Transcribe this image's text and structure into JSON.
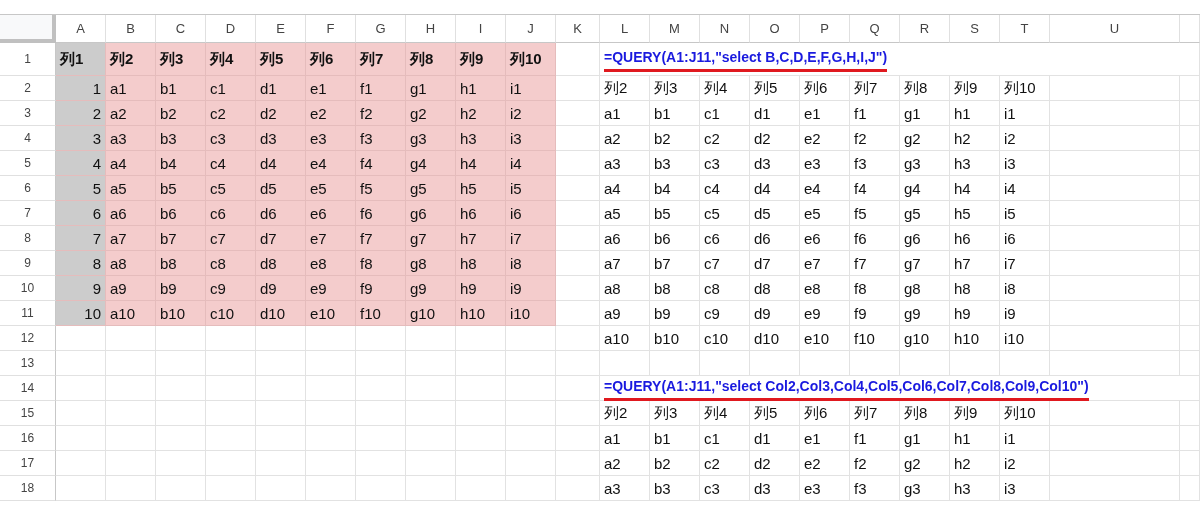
{
  "columns": [
    "A",
    "B",
    "C",
    "D",
    "E",
    "F",
    "G",
    "H",
    "I",
    "J",
    "K",
    "L",
    "M",
    "N",
    "O",
    "P",
    "Q",
    "R",
    "S",
    "T",
    "U"
  ],
  "rows": [
    {
      "number": "1",
      "cells": [
        {
          "kind": "key_header",
          "text": "列1"
        },
        {
          "kind": "header",
          "text": "列2"
        },
        {
          "kind": "header",
          "text": "列3"
        },
        {
          "kind": "header",
          "text": "列4"
        },
        {
          "kind": "header",
          "text": "列5"
        },
        {
          "kind": "header",
          "text": "列6"
        },
        {
          "kind": "header",
          "text": "列7"
        },
        {
          "kind": "header",
          "text": "列8"
        },
        {
          "kind": "header",
          "text": "列9"
        },
        {
          "kind": "header",
          "text": "列10"
        },
        null,
        {
          "kind": "formula",
          "text": "=QUERY(A1:J11,\"select B,C,D,E,F,G,H,I,J\")"
        }
      ]
    },
    {
      "number": "2",
      "cells": [
        {
          "kind": "key",
          "text": "1"
        },
        {
          "kind": "data",
          "text": "a1"
        },
        {
          "kind": "data",
          "text": "b1"
        },
        {
          "kind": "data",
          "text": "c1"
        },
        {
          "kind": "data",
          "text": "d1"
        },
        {
          "kind": "data",
          "text": "e1"
        },
        {
          "kind": "data",
          "text": "f1"
        },
        {
          "kind": "data",
          "text": "g1"
        },
        {
          "kind": "data",
          "text": "h1"
        },
        {
          "kind": "data",
          "text": "i1"
        },
        null,
        {
          "kind": "output",
          "text": "列2"
        },
        {
          "kind": "output",
          "text": "列3"
        },
        {
          "kind": "output",
          "text": "列4"
        },
        {
          "kind": "output",
          "text": "列5"
        },
        {
          "kind": "output",
          "text": "列6"
        },
        {
          "kind": "output",
          "text": "列7"
        },
        {
          "kind": "output",
          "text": "列8"
        },
        {
          "kind": "output",
          "text": "列9"
        },
        {
          "kind": "output",
          "text": "列10"
        }
      ]
    },
    {
      "number": "3",
      "cells": [
        {
          "kind": "key",
          "text": "2"
        },
        {
          "kind": "data",
          "text": "a2"
        },
        {
          "kind": "data",
          "text": "b2"
        },
        {
          "kind": "data",
          "text": "c2"
        },
        {
          "kind": "data",
          "text": "d2"
        },
        {
          "kind": "data",
          "text": "e2"
        },
        {
          "kind": "data",
          "text": "f2"
        },
        {
          "kind": "data",
          "text": "g2"
        },
        {
          "kind": "data",
          "text": "h2"
        },
        {
          "kind": "data",
          "text": "i2"
        },
        null,
        {
          "kind": "output",
          "text": "a1"
        },
        {
          "kind": "output",
          "text": "b1"
        },
        {
          "kind": "output",
          "text": "c1"
        },
        {
          "kind": "output",
          "text": "d1"
        },
        {
          "kind": "output",
          "text": "e1"
        },
        {
          "kind": "output",
          "text": "f1"
        },
        {
          "kind": "output",
          "text": "g1"
        },
        {
          "kind": "output",
          "text": "h1"
        },
        {
          "kind": "output",
          "text": "i1"
        }
      ]
    },
    {
      "number": "4",
      "cells": [
        {
          "kind": "key",
          "text": "3"
        },
        {
          "kind": "data",
          "text": "a3"
        },
        {
          "kind": "data",
          "text": "b3"
        },
        {
          "kind": "data",
          "text": "c3"
        },
        {
          "kind": "data",
          "text": "d3"
        },
        {
          "kind": "data",
          "text": "e3"
        },
        {
          "kind": "data",
          "text": "f3"
        },
        {
          "kind": "data",
          "text": "g3"
        },
        {
          "kind": "data",
          "text": "h3"
        },
        {
          "kind": "data",
          "text": "i3"
        },
        null,
        {
          "kind": "output",
          "text": "a2"
        },
        {
          "kind": "output",
          "text": "b2"
        },
        {
          "kind": "output",
          "text": "c2"
        },
        {
          "kind": "output",
          "text": "d2"
        },
        {
          "kind": "output",
          "text": "e2"
        },
        {
          "kind": "output",
          "text": "f2"
        },
        {
          "kind": "output",
          "text": "g2"
        },
        {
          "kind": "output",
          "text": "h2"
        },
        {
          "kind": "output",
          "text": "i2"
        }
      ]
    },
    {
      "number": "5",
      "cells": [
        {
          "kind": "key",
          "text": "4"
        },
        {
          "kind": "data",
          "text": "a4"
        },
        {
          "kind": "data",
          "text": "b4"
        },
        {
          "kind": "data",
          "text": "c4"
        },
        {
          "kind": "data",
          "text": "d4"
        },
        {
          "kind": "data",
          "text": "e4"
        },
        {
          "kind": "data",
          "text": "f4"
        },
        {
          "kind": "data",
          "text": "g4"
        },
        {
          "kind": "data",
          "text": "h4"
        },
        {
          "kind": "data",
          "text": "i4"
        },
        null,
        {
          "kind": "output",
          "text": "a3"
        },
        {
          "kind": "output",
          "text": "b3"
        },
        {
          "kind": "output",
          "text": "c3"
        },
        {
          "kind": "output",
          "text": "d3"
        },
        {
          "kind": "output",
          "text": "e3"
        },
        {
          "kind": "output",
          "text": "f3"
        },
        {
          "kind": "output",
          "text": "g3"
        },
        {
          "kind": "output",
          "text": "h3"
        },
        {
          "kind": "output",
          "text": "i3"
        }
      ]
    },
    {
      "number": "6",
      "cells": [
        {
          "kind": "key",
          "text": "5"
        },
        {
          "kind": "data",
          "text": "a5"
        },
        {
          "kind": "data",
          "text": "b5"
        },
        {
          "kind": "data",
          "text": "c5"
        },
        {
          "kind": "data",
          "text": "d5"
        },
        {
          "kind": "data",
          "text": "e5"
        },
        {
          "kind": "data",
          "text": "f5"
        },
        {
          "kind": "data",
          "text": "g5"
        },
        {
          "kind": "data",
          "text": "h5"
        },
        {
          "kind": "data",
          "text": "i5"
        },
        null,
        {
          "kind": "output",
          "text": "a4"
        },
        {
          "kind": "output",
          "text": "b4"
        },
        {
          "kind": "output",
          "text": "c4"
        },
        {
          "kind": "output",
          "text": "d4"
        },
        {
          "kind": "output",
          "text": "e4"
        },
        {
          "kind": "output",
          "text": "f4"
        },
        {
          "kind": "output",
          "text": "g4"
        },
        {
          "kind": "output",
          "text": "h4"
        },
        {
          "kind": "output",
          "text": "i4"
        }
      ]
    },
    {
      "number": "7",
      "cells": [
        {
          "kind": "key",
          "text": "6"
        },
        {
          "kind": "data",
          "text": "a6"
        },
        {
          "kind": "data",
          "text": "b6"
        },
        {
          "kind": "data",
          "text": "c6"
        },
        {
          "kind": "data",
          "text": "d6"
        },
        {
          "kind": "data",
          "text": "e6"
        },
        {
          "kind": "data",
          "text": "f6"
        },
        {
          "kind": "data",
          "text": "g6"
        },
        {
          "kind": "data",
          "text": "h6"
        },
        {
          "kind": "data",
          "text": "i6"
        },
        null,
        {
          "kind": "output",
          "text": "a5"
        },
        {
          "kind": "output",
          "text": "b5"
        },
        {
          "kind": "output",
          "text": "c5"
        },
        {
          "kind": "output",
          "text": "d5"
        },
        {
          "kind": "output",
          "text": "e5"
        },
        {
          "kind": "output",
          "text": "f5"
        },
        {
          "kind": "output",
          "text": "g5"
        },
        {
          "kind": "output",
          "text": "h5"
        },
        {
          "kind": "output",
          "text": "i5"
        }
      ]
    },
    {
      "number": "8",
      "cells": [
        {
          "kind": "key",
          "text": "7"
        },
        {
          "kind": "data",
          "text": "a7"
        },
        {
          "kind": "data",
          "text": "b7"
        },
        {
          "kind": "data",
          "text": "c7"
        },
        {
          "kind": "data",
          "text": "d7"
        },
        {
          "kind": "data",
          "text": "e7"
        },
        {
          "kind": "data",
          "text": "f7"
        },
        {
          "kind": "data",
          "text": "g7"
        },
        {
          "kind": "data",
          "text": "h7"
        },
        {
          "kind": "data",
          "text": "i7"
        },
        null,
        {
          "kind": "output",
          "text": "a6"
        },
        {
          "kind": "output",
          "text": "b6"
        },
        {
          "kind": "output",
          "text": "c6"
        },
        {
          "kind": "output",
          "text": "d6"
        },
        {
          "kind": "output",
          "text": "e6"
        },
        {
          "kind": "output",
          "text": "f6"
        },
        {
          "kind": "output",
          "text": "g6"
        },
        {
          "kind": "output",
          "text": "h6"
        },
        {
          "kind": "output",
          "text": "i6"
        }
      ]
    },
    {
      "number": "9",
      "cells": [
        {
          "kind": "key",
          "text": "8"
        },
        {
          "kind": "data",
          "text": "a8"
        },
        {
          "kind": "data",
          "text": "b8"
        },
        {
          "kind": "data",
          "text": "c8"
        },
        {
          "kind": "data",
          "text": "d8"
        },
        {
          "kind": "data",
          "text": "e8"
        },
        {
          "kind": "data",
          "text": "f8"
        },
        {
          "kind": "data",
          "text": "g8"
        },
        {
          "kind": "data",
          "text": "h8"
        },
        {
          "kind": "data",
          "text": "i8"
        },
        null,
        {
          "kind": "output",
          "text": "a7"
        },
        {
          "kind": "output",
          "text": "b7"
        },
        {
          "kind": "output",
          "text": "c7"
        },
        {
          "kind": "output",
          "text": "d7"
        },
        {
          "kind": "output",
          "text": "e7"
        },
        {
          "kind": "output",
          "text": "f7"
        },
        {
          "kind": "output",
          "text": "g7"
        },
        {
          "kind": "output",
          "text": "h7"
        },
        {
          "kind": "output",
          "text": "i7"
        }
      ]
    },
    {
      "number": "10",
      "cells": [
        {
          "kind": "key",
          "text": "9"
        },
        {
          "kind": "data",
          "text": "a9"
        },
        {
          "kind": "data",
          "text": "b9"
        },
        {
          "kind": "data",
          "text": "c9"
        },
        {
          "kind": "data",
          "text": "d9"
        },
        {
          "kind": "data",
          "text": "e9"
        },
        {
          "kind": "data",
          "text": "f9"
        },
        {
          "kind": "data",
          "text": "g9"
        },
        {
          "kind": "data",
          "text": "h9"
        },
        {
          "kind": "data",
          "text": "i9"
        },
        null,
        {
          "kind": "output",
          "text": "a8"
        },
        {
          "kind": "output",
          "text": "b8"
        },
        {
          "kind": "output",
          "text": "c8"
        },
        {
          "kind": "output",
          "text": "d8"
        },
        {
          "kind": "output",
          "text": "e8"
        },
        {
          "kind": "output",
          "text": "f8"
        },
        {
          "kind": "output",
          "text": "g8"
        },
        {
          "kind": "output",
          "text": "h8"
        },
        {
          "kind": "output",
          "text": "i8"
        }
      ]
    },
    {
      "number": "11",
      "cells": [
        {
          "kind": "key",
          "text": "10"
        },
        {
          "kind": "data",
          "text": "a10"
        },
        {
          "kind": "data",
          "text": "b10"
        },
        {
          "kind": "data",
          "text": "c10"
        },
        {
          "kind": "data",
          "text": "d10"
        },
        {
          "kind": "data",
          "text": "e10"
        },
        {
          "kind": "data",
          "text": "f10"
        },
        {
          "kind": "data",
          "text": "g10"
        },
        {
          "kind": "data",
          "text": "h10"
        },
        {
          "kind": "data",
          "text": "i10"
        },
        null,
        {
          "kind": "output",
          "text": "a9"
        },
        {
          "kind": "output",
          "text": "b9"
        },
        {
          "kind": "output",
          "text": "c9"
        },
        {
          "kind": "output",
          "text": "d9"
        },
        {
          "kind": "output",
          "text": "e9"
        },
        {
          "kind": "output",
          "text": "f9"
        },
        {
          "kind": "output",
          "text": "g9"
        },
        {
          "kind": "output",
          "text": "h9"
        },
        {
          "kind": "output",
          "text": "i9"
        }
      ]
    },
    {
      "number": "12",
      "cells": [
        null,
        null,
        null,
        null,
        null,
        null,
        null,
        null,
        null,
        null,
        null,
        {
          "kind": "output",
          "text": "a10"
        },
        {
          "kind": "output",
          "text": "b10"
        },
        {
          "kind": "output",
          "text": "c10"
        },
        {
          "kind": "output",
          "text": "d10"
        },
        {
          "kind": "output",
          "text": "e10"
        },
        {
          "kind": "output",
          "text": "f10"
        },
        {
          "kind": "output",
          "text": "g10"
        },
        {
          "kind": "output",
          "text": "h10"
        },
        {
          "kind": "output",
          "text": "i10"
        }
      ]
    },
    {
      "number": "13",
      "cells": []
    },
    {
      "number": "14",
      "cells": [
        null,
        null,
        null,
        null,
        null,
        null,
        null,
        null,
        null,
        null,
        null,
        {
          "kind": "formula",
          "text": "=QUERY(A1:J11,\"select Col2,Col3,Col4,Col5,Col6,Col7,Col8,Col9,Col10\")"
        }
      ]
    },
    {
      "number": "15",
      "cells": [
        null,
        null,
        null,
        null,
        null,
        null,
        null,
        null,
        null,
        null,
        null,
        {
          "kind": "output",
          "text": "列2"
        },
        {
          "kind": "output",
          "text": "列3"
        },
        {
          "kind": "output",
          "text": "列4"
        },
        {
          "kind": "output",
          "text": "列5"
        },
        {
          "kind": "output",
          "text": "列6"
        },
        {
          "kind": "output",
          "text": "列7"
        },
        {
          "kind": "output",
          "text": "列8"
        },
        {
          "kind": "output",
          "text": "列9"
        },
        {
          "kind": "output",
          "text": "列10"
        }
      ]
    },
    {
      "number": "16",
      "cells": [
        null,
        null,
        null,
        null,
        null,
        null,
        null,
        null,
        null,
        null,
        null,
        {
          "kind": "output",
          "text": "a1"
        },
        {
          "kind": "output",
          "text": "b1"
        },
        {
          "kind": "output",
          "text": "c1"
        },
        {
          "kind": "output",
          "text": "d1"
        },
        {
          "kind": "output",
          "text": "e1"
        },
        {
          "kind": "output",
          "text": "f1"
        },
        {
          "kind": "output",
          "text": "g1"
        },
        {
          "kind": "output",
          "text": "h1"
        },
        {
          "kind": "output",
          "text": "i1"
        }
      ]
    },
    {
      "number": "17",
      "cells": [
        null,
        null,
        null,
        null,
        null,
        null,
        null,
        null,
        null,
        null,
        null,
        {
          "kind": "output",
          "text": "a2"
        },
        {
          "kind": "output",
          "text": "b2"
        },
        {
          "kind": "output",
          "text": "c2"
        },
        {
          "kind": "output",
          "text": "d2"
        },
        {
          "kind": "output",
          "text": "e2"
        },
        {
          "kind": "output",
          "text": "f2"
        },
        {
          "kind": "output",
          "text": "g2"
        },
        {
          "kind": "output",
          "text": "h2"
        },
        {
          "kind": "output",
          "text": "i2"
        }
      ]
    },
    {
      "number": "18",
      "cells": [
        null,
        null,
        null,
        null,
        null,
        null,
        null,
        null,
        null,
        null,
        null,
        {
          "kind": "output",
          "text": "a3"
        },
        {
          "kind": "output",
          "text": "b3"
        },
        {
          "kind": "output",
          "text": "c3"
        },
        {
          "kind": "output",
          "text": "d3"
        },
        {
          "kind": "output",
          "text": "e3"
        },
        {
          "kind": "output",
          "text": "f3"
        },
        {
          "kind": "output",
          "text": "g3"
        },
        {
          "kind": "output",
          "text": "h3"
        },
        {
          "kind": "output",
          "text": "i3"
        }
      ]
    }
  ]
}
